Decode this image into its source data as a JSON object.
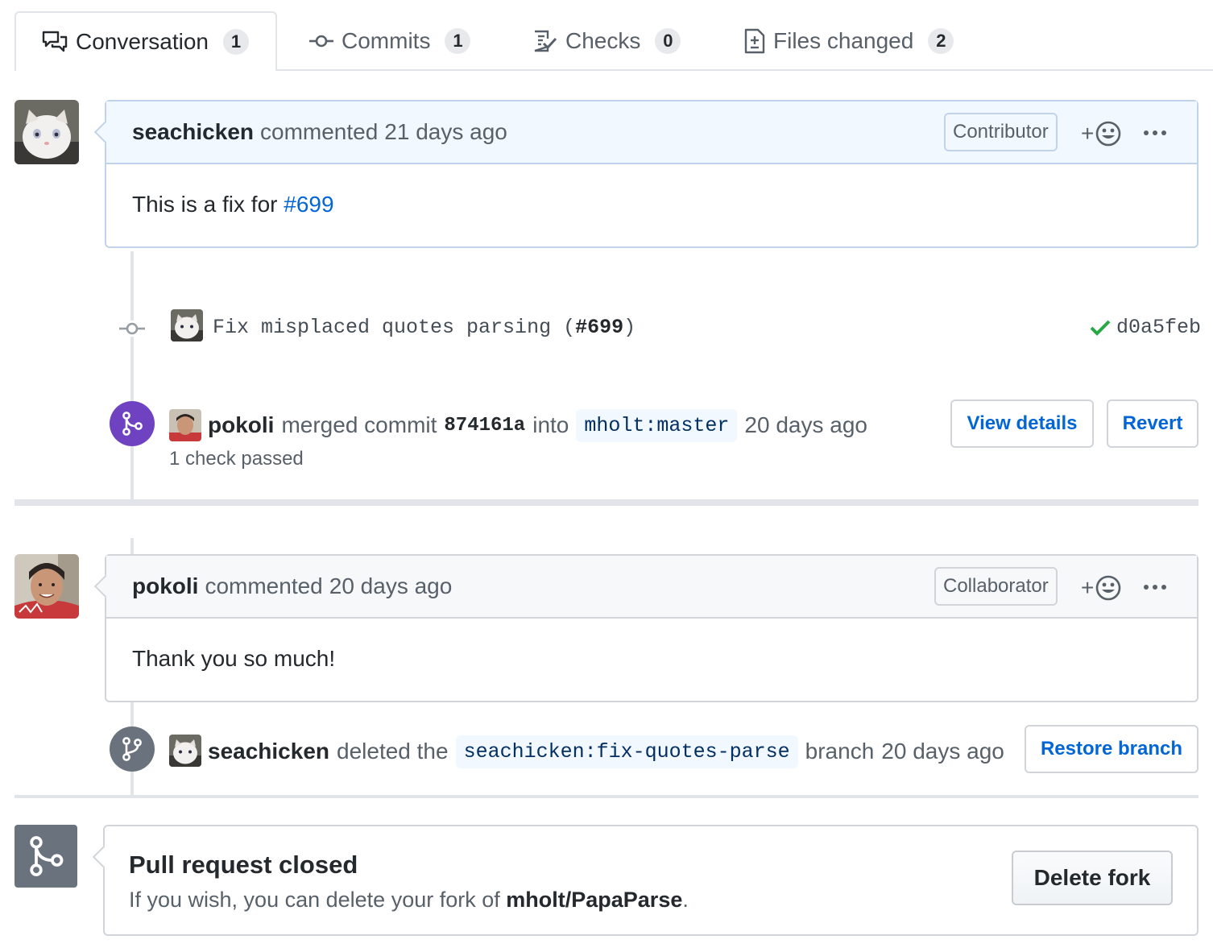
{
  "tabs": [
    {
      "label": "Conversation",
      "count": "1"
    },
    {
      "label": "Commits",
      "count": "1"
    },
    {
      "label": "Checks",
      "count": "0"
    },
    {
      "label": "Files changed",
      "count": "2"
    }
  ],
  "comment1": {
    "author": "seachicken",
    "action": "commented",
    "time": "21 days ago",
    "role": "Contributor",
    "body_prefix": "This is a fix for",
    "body_link": "#699"
  },
  "commit": {
    "message": "Fix misplaced quotes parsing (",
    "issue_ref": "#699",
    "message_suffix": ")",
    "sha": "d0a5feb"
  },
  "merge_event": {
    "actor": "pokoli",
    "action": "merged commit",
    "commit_sha": "874161a",
    "into_label": "into",
    "target_branch": "mholt:master",
    "time": "20 days ago",
    "checks": "1 check passed",
    "view_details_label": "View details",
    "revert_label": "Revert"
  },
  "comment2": {
    "author": "pokoli",
    "action": "commented",
    "time": "20 days ago",
    "role": "Collaborator",
    "body": "Thank you so much!"
  },
  "delete_event": {
    "actor": "seachicken",
    "action": "deleted the",
    "branch": "seachicken:fix-quotes-parse",
    "suffix": "branch",
    "time": "20 days ago",
    "restore_label": "Restore branch"
  },
  "closed": {
    "title": "Pull request closed",
    "desc_prefix": "If you wish, you can delete your fork of",
    "repo": "mholt/PapaParse",
    "desc_suffix": ".",
    "delete_fork_label": "Delete fork"
  },
  "colors": {
    "link": "#0366d6",
    "merged": "#6f42c1",
    "closed_badge": "#6a737d",
    "success": "#28a745"
  }
}
